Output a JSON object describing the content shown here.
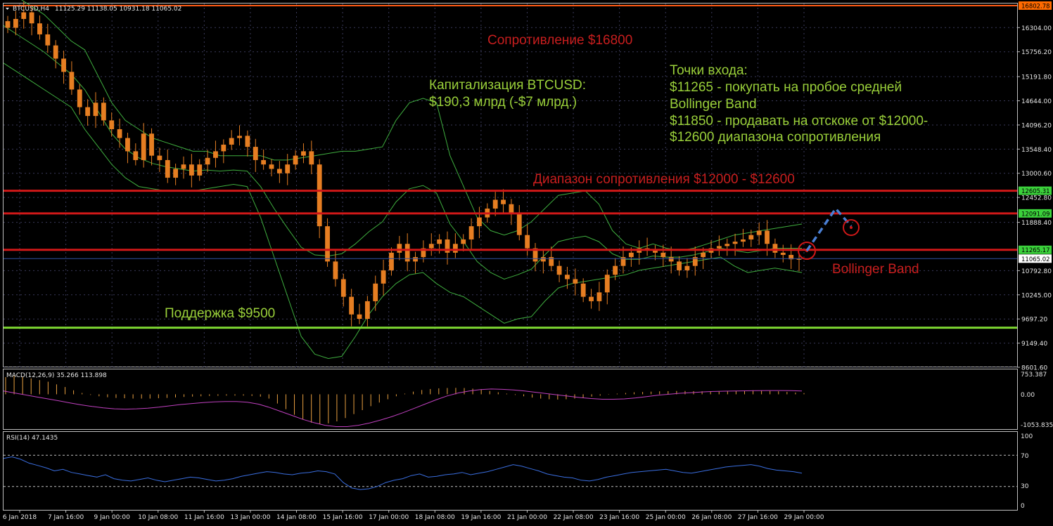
{
  "header": {
    "symbol": "BTCUSD,H4",
    "ohlc": "11125.29 11138.05 10931.18 11065.02"
  },
  "price_axis": {
    "ticks": [
      "16304.00",
      "15756.20",
      "15191.80",
      "14644.00",
      "14096.20",
      "13548.40",
      "13000.60",
      "12452.80",
      "11888.40",
      "10792.80",
      "10245.00",
      "9697.20",
      "9149.40",
      "8601.60"
    ],
    "tags": [
      {
        "label": "16802.78",
        "value": 16802.78,
        "color": "#ff6a00"
      },
      {
        "label": "12605.31",
        "value": 12605.31,
        "color": "#3bd13b"
      },
      {
        "label": "12091.09",
        "value": 12091.09,
        "color": "#3bd13b"
      },
      {
        "label": "11265.17",
        "value": 11265.17,
        "color": "#3bd13b"
      },
      {
        "label": "11065.02",
        "value": 11065.02,
        "color": "#ffffff"
      }
    ]
  },
  "macd_panel": {
    "label": "MACD(12,26,9) 35.266 113.898",
    "ticks": [
      "753.387",
      "0.00",
      "-1053.835"
    ]
  },
  "rsi_panel": {
    "label": "RSI(14) 47.1435",
    "ticks": [
      "100",
      "70",
      "30",
      "0"
    ]
  },
  "time_axis": {
    "labels": [
      "6 Jan 2018",
      "7 Jan 16:00",
      "9 Jan 00:00",
      "10 Jan 08:00",
      "11 Jan 16:00",
      "13 Jan 00:00",
      "14 Jan 08:00",
      "15 Jan 16:00",
      "17 Jan 00:00",
      "18 Jan 08:00",
      "19 Jan 16:00",
      "21 Jan 00:00",
      "22 Jan 08:00",
      "23 Jan 16:00",
      "25 Jan 00:00",
      "26 Jan 08:00",
      "27 Jan 16:00",
      "29 Jan 00:00"
    ]
  },
  "annotations": {
    "resistance_16800": "Сопротивление $16800",
    "cap_line1": "Капитализация BTCUSD:",
    "cap_line2": "$190,3 млрд (-$7 млрд.)",
    "entry_lines": [
      "Точки входа:",
      "$11265 - покупать на пробое средней",
      "Bollinger Band",
      "$11850 - продавать на отскоке от $12000-",
      "$12600 диапазона сопротивления"
    ],
    "resistance_range": "Диапазон сопротивления $12000 - $12600",
    "bollinger": "Bollinger Band",
    "support": "Поддержка $9500"
  },
  "colors": {
    "background": "#000000",
    "candle": "#e67e22",
    "bollinger": "#3fae3f",
    "resistance_line": "#d01818",
    "top_line": "#ff5a14",
    "support_line": "#7dd631",
    "macd_hist": "#e8a040",
    "macd_signal": "#c040c0",
    "rsi": "#3a6ee0",
    "grid": "#3a3a5a",
    "dashed_arrow": "#4a7fd4",
    "annotation_red": "#c81e1e",
    "annotation_green": "#9ad03a"
  },
  "chart_data": {
    "type": "candlestick",
    "symbol": "BTCUSD",
    "timeframe": "H4",
    "ylim": [
      8601.6,
      16850
    ],
    "horizontal_levels": [
      16802.78,
      12605.31,
      12091.09,
      11265.17,
      9500
    ],
    "close_series": [
      16300,
      16500,
      16650,
      16400,
      16150,
      15900,
      15600,
      15300,
      14900,
      14500,
      14300,
      14600,
      14200,
      14000,
      13800,
      13500,
      13300,
      13900,
      13400,
      13300,
      12900,
      13100,
      13200,
      12950,
      13200,
      13350,
      13500,
      13650,
      13800,
      13850,
      13600,
      13300,
      13200,
      13100,
      13000,
      13200,
      13400,
      13500,
      13200,
      11800,
      11000,
      10600,
      10200,
      9800,
      9700,
      10100,
      10500,
      10800,
      11200,
      11400,
      11000,
      11100,
      11300,
      11400,
      11500,
      11200,
      11400,
      11500,
      11800,
      12000,
      12200,
      12400,
      12300,
      12100,
      11600,
      11300,
      11000,
      11100,
      10900,
      10700,
      10600,
      10500,
      10200,
      10100,
      10300,
      10700,
      10900,
      11100,
      11200,
      11300,
      11250,
      11200,
      11100,
      11000,
      10800,
      10900,
      11100,
      11200,
      11300,
      11350,
      11400,
      11450,
      11500,
      11600,
      11700,
      11400,
      11200,
      11150,
      11050,
      11065
    ],
    "bollinger_upper": [
      17200,
      17000,
      16800,
      16600,
      16300,
      16000,
      15800,
      15200,
      14600,
      14200,
      14000,
      13800,
      13700,
      13600,
      13500,
      13500,
      13400,
      13400,
      13400,
      13400,
      13300,
      13300,
      13350,
      13400,
      13450,
      13500,
      13500,
      13550,
      13600,
      14200,
      14600,
      14700,
      14600,
      13400,
      12700,
      12000,
      11700,
      11600,
      11700,
      11900,
      12200,
      12500,
      12550,
      12600,
      12300,
      11700,
      11400,
      11300,
      11400,
      11300,
      11250,
      11300,
      11400,
      11500,
      11600,
      11650,
      11700,
      11750,
      11800,
      11850
    ],
    "bollinger_lower": [
      15500,
      15300,
      15100,
      14900,
      14700,
      14500,
      14000,
      13600,
      13200,
      12900,
      12700,
      12650,
      12600,
      12600,
      12600,
      12650,
      12700,
      12750,
      12700,
      12000,
      11100,
      10200,
      9300,
      8900,
      8800,
      8850,
      9300,
      9800,
      10200,
      10500,
      10700,
      10750,
      10500,
      10300,
      10200,
      10000,
      9800,
      9600,
      9700,
      9750,
      10100,
      10400,
      10500,
      10550,
      10600,
      10650,
      10700,
      10800,
      10850,
      10900,
      10950,
      11000,
      11050,
      11100,
      10900,
      10750,
      10800,
      10850,
      10800,
      10750
    ],
    "macd_hist": [
      520,
      560,
      540,
      480,
      430,
      380,
      300,
      220,
      120,
      40,
      -20,
      -60,
      -90,
      -110,
      -120,
      -130,
      -130,
      -130,
      -120,
      -110,
      -95,
      -80,
      -70,
      -60,
      -50,
      -45,
      -40,
      -40,
      -40,
      -50,
      -70,
      -130,
      -280,
      -450,
      -620,
      -760,
      -860,
      -900,
      -880,
      -820,
      -720,
      -600,
      -480,
      -360,
      -250,
      -150,
      -60,
      20,
      80,
      130,
      160,
      180,
      190,
      195,
      190,
      170,
      140,
      100,
      60,
      20,
      -20,
      -60,
      -100,
      -130,
      -150,
      -160,
      -150,
      -130,
      -100,
      -70,
      -40,
      -10,
      20,
      40,
      60,
      70,
      80,
      90,
      95,
      100,
      100,
      95,
      90,
      85,
      80,
      90,
      100,
      110,
      120,
      110,
      100,
      90,
      70,
      50,
      35
    ],
    "macd_signal": [
      100,
      40,
      -20,
      -80,
      -140,
      -200,
      -260,
      -320,
      -370,
      -410,
      -440,
      -450,
      -440,
      -420,
      -390,
      -350,
      -310,
      -280,
      -250,
      -230,
      -220,
      -220,
      -240,
      -300,
      -400,
      -520,
      -640,
      -760,
      -860,
      -940,
      -980,
      -980,
      -940,
      -870,
      -780,
      -680,
      -560,
      -430,
      -300,
      -170,
      -50,
      40,
      100,
      140,
      160,
      150,
      130,
      100,
      60,
      20,
      -20,
      -60,
      -100,
      -130,
      -150,
      -150,
      -140,
      -110,
      -70,
      -30,
      0,
      30,
      50,
      70,
      85,
      95,
      100,
      105,
      110,
      114,
      114,
      110,
      100
    ],
    "rsi": [
      66,
      68,
      65,
      60,
      57,
      54,
      50,
      52,
      48,
      46,
      44,
      42,
      45,
      40,
      38,
      37,
      39,
      41,
      38,
      36,
      38,
      40,
      42,
      41,
      39,
      37,
      38,
      40,
      43,
      45,
      47,
      49,
      48,
      46,
      45,
      47,
      48,
      50,
      49,
      46,
      35,
      28,
      26,
      27,
      30,
      35,
      38,
      40,
      44,
      46,
      42,
      43,
      45,
      46,
      48,
      45,
      47,
      49,
      52,
      55,
      58,
      56,
      53,
      50,
      46,
      44,
      42,
      41,
      38,
      37,
      39,
      42,
      44,
      46,
      48,
      49,
      50,
      51,
      52,
      50,
      48,
      47,
      49,
      51,
      53,
      55,
      56,
      57,
      58,
      56,
      53,
      51,
      50,
      49,
      47
    ]
  }
}
